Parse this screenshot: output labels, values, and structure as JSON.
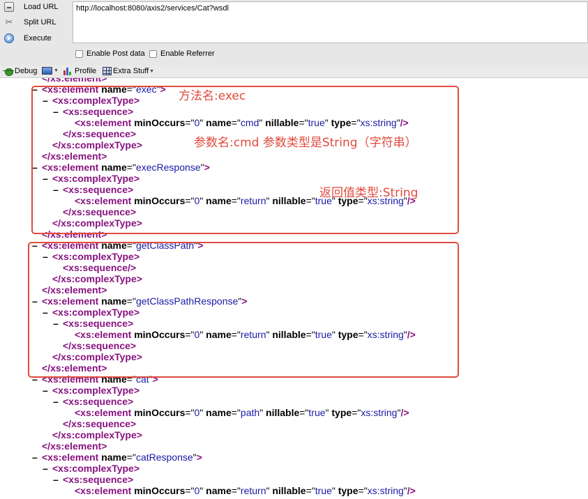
{
  "hackbar": {
    "load_url": "Load URL",
    "split_url": "Split URL",
    "execute": "Execute",
    "url_value": "http://localhost:8080/axis2/services/Cat?wsdl",
    "enable_post": "Enable Post data",
    "enable_referrer": "Enable Referrer"
  },
  "toolbar": {
    "debug": "Debug",
    "profile": "Profile",
    "extra": "Extra Stuff"
  },
  "annotations": {
    "method_name": "方法名:exec",
    "param": "参数名:cmd 参数类型是String（字符串）",
    "return_type": "返回值类型:String"
  },
  "xml_lines": [
    {
      "indent": 60,
      "toggle": "",
      "parts": [
        [
          "t",
          "</xs:element>"
        ]
      ]
    },
    {
      "indent": 60,
      "toggle": "–",
      "parts": [
        [
          "t",
          "<xs:element "
        ],
        [
          "an",
          "name"
        ],
        [
          "pl",
          "=\""
        ],
        [
          "av",
          "exec"
        ],
        [
          "pl",
          "\""
        ],
        [
          "t",
          ">"
        ]
      ]
    },
    {
      "indent": 75,
      "toggle": "–",
      "parts": [
        [
          "t",
          "<xs:complexType>"
        ]
      ]
    },
    {
      "indent": 90,
      "toggle": "–",
      "parts": [
        [
          "t",
          "<xs:sequence>"
        ]
      ]
    },
    {
      "indent": 107,
      "toggle": "",
      "parts": [
        [
          "t",
          "<xs:element "
        ],
        [
          "an",
          "minOccurs"
        ],
        [
          "pl",
          "=\""
        ],
        [
          "av",
          "0"
        ],
        [
          "pl",
          "\" "
        ],
        [
          "an",
          "name"
        ],
        [
          "pl",
          "=\""
        ],
        [
          "av",
          "cmd"
        ],
        [
          "pl",
          "\" "
        ],
        [
          "an",
          "nillable"
        ],
        [
          "pl",
          "=\""
        ],
        [
          "av",
          "true"
        ],
        [
          "pl",
          "\" "
        ],
        [
          "an",
          "type"
        ],
        [
          "pl",
          "=\""
        ],
        [
          "av",
          "xs:string"
        ],
        [
          "pl",
          "\""
        ],
        [
          "t",
          "/>"
        ]
      ]
    },
    {
      "indent": 90,
      "toggle": "",
      "parts": [
        [
          "t",
          "</xs:sequence>"
        ]
      ]
    },
    {
      "indent": 75,
      "toggle": "",
      "parts": [
        [
          "t",
          "</xs:complexType>"
        ]
      ]
    },
    {
      "indent": 60,
      "toggle": "",
      "parts": [
        [
          "t",
          "</xs:element>"
        ]
      ]
    },
    {
      "indent": 60,
      "toggle": "–",
      "parts": [
        [
          "t",
          "<xs:element "
        ],
        [
          "an",
          "name"
        ],
        [
          "pl",
          "=\""
        ],
        [
          "av",
          "execResponse"
        ],
        [
          "pl",
          "\""
        ],
        [
          "t",
          ">"
        ]
      ]
    },
    {
      "indent": 75,
      "toggle": "–",
      "parts": [
        [
          "t",
          "<xs:complexType>"
        ]
      ]
    },
    {
      "indent": 90,
      "toggle": "–",
      "parts": [
        [
          "t",
          "<xs:sequence>"
        ]
      ]
    },
    {
      "indent": 107,
      "toggle": "",
      "parts": [
        [
          "t",
          "<xs:element "
        ],
        [
          "an",
          "minOccurs"
        ],
        [
          "pl",
          "=\""
        ],
        [
          "av",
          "0"
        ],
        [
          "pl",
          "\" "
        ],
        [
          "an",
          "name"
        ],
        [
          "pl",
          "=\""
        ],
        [
          "av",
          "return"
        ],
        [
          "pl",
          "\" "
        ],
        [
          "an",
          "nillable"
        ],
        [
          "pl",
          "=\""
        ],
        [
          "av",
          "true"
        ],
        [
          "pl",
          "\" "
        ],
        [
          "an",
          "type"
        ],
        [
          "pl",
          "=\""
        ],
        [
          "av",
          "xs:string"
        ],
        [
          "pl",
          "\""
        ],
        [
          "t",
          "/>"
        ]
      ]
    },
    {
      "indent": 90,
      "toggle": "",
      "parts": [
        [
          "t",
          "</xs:sequence>"
        ]
      ]
    },
    {
      "indent": 75,
      "toggle": "",
      "parts": [
        [
          "t",
          "</xs:complexType>"
        ]
      ]
    },
    {
      "indent": 60,
      "toggle": "",
      "parts": [
        [
          "t",
          "</xs:element>"
        ]
      ]
    },
    {
      "indent": 60,
      "toggle": "–",
      "parts": [
        [
          "t",
          "<xs:element "
        ],
        [
          "an",
          "name"
        ],
        [
          "pl",
          "=\""
        ],
        [
          "av",
          "getClassPath"
        ],
        [
          "pl",
          "\""
        ],
        [
          "t",
          ">"
        ]
      ]
    },
    {
      "indent": 75,
      "toggle": "–",
      "parts": [
        [
          "t",
          "<xs:complexType>"
        ]
      ]
    },
    {
      "indent": 90,
      "toggle": "",
      "parts": [
        [
          "t",
          "<xs:sequence/>"
        ]
      ]
    },
    {
      "indent": 75,
      "toggle": "",
      "parts": [
        [
          "t",
          "</xs:complexType>"
        ]
      ]
    },
    {
      "indent": 60,
      "toggle": "",
      "parts": [
        [
          "t",
          "</xs:element>"
        ]
      ]
    },
    {
      "indent": 60,
      "toggle": "–",
      "parts": [
        [
          "t",
          "<xs:element "
        ],
        [
          "an",
          "name"
        ],
        [
          "pl",
          "=\""
        ],
        [
          "av",
          "getClassPathResponse"
        ],
        [
          "pl",
          "\""
        ],
        [
          "t",
          ">"
        ]
      ]
    },
    {
      "indent": 75,
      "toggle": "–",
      "parts": [
        [
          "t",
          "<xs:complexType>"
        ]
      ]
    },
    {
      "indent": 90,
      "toggle": "–",
      "parts": [
        [
          "t",
          "<xs:sequence>"
        ]
      ]
    },
    {
      "indent": 107,
      "toggle": "",
      "parts": [
        [
          "t",
          "<xs:element "
        ],
        [
          "an",
          "minOccurs"
        ],
        [
          "pl",
          "=\""
        ],
        [
          "av",
          "0"
        ],
        [
          "pl",
          "\" "
        ],
        [
          "an",
          "name"
        ],
        [
          "pl",
          "=\""
        ],
        [
          "av",
          "return"
        ],
        [
          "pl",
          "\" "
        ],
        [
          "an",
          "nillable"
        ],
        [
          "pl",
          "=\""
        ],
        [
          "av",
          "true"
        ],
        [
          "pl",
          "\" "
        ],
        [
          "an",
          "type"
        ],
        [
          "pl",
          "=\""
        ],
        [
          "av",
          "xs:string"
        ],
        [
          "pl",
          "\""
        ],
        [
          "t",
          "/>"
        ]
      ]
    },
    {
      "indent": 90,
      "toggle": "",
      "parts": [
        [
          "t",
          "</xs:sequence>"
        ]
      ]
    },
    {
      "indent": 75,
      "toggle": "",
      "parts": [
        [
          "t",
          "</xs:complexType>"
        ]
      ]
    },
    {
      "indent": 60,
      "toggle": "",
      "parts": [
        [
          "t",
          "</xs:element>"
        ]
      ]
    },
    {
      "indent": 60,
      "toggle": "–",
      "parts": [
        [
          "t",
          "<xs:element "
        ],
        [
          "an",
          "name"
        ],
        [
          "pl",
          "=\""
        ],
        [
          "av",
          "cat"
        ],
        [
          "pl",
          "\""
        ],
        [
          "t",
          ">"
        ]
      ]
    },
    {
      "indent": 75,
      "toggle": "–",
      "parts": [
        [
          "t",
          "<xs:complexType>"
        ]
      ]
    },
    {
      "indent": 90,
      "toggle": "–",
      "parts": [
        [
          "t",
          "<xs:sequence>"
        ]
      ]
    },
    {
      "indent": 107,
      "toggle": "",
      "parts": [
        [
          "t",
          "<xs:element "
        ],
        [
          "an",
          "minOccurs"
        ],
        [
          "pl",
          "=\""
        ],
        [
          "av",
          "0"
        ],
        [
          "pl",
          "\" "
        ],
        [
          "an",
          "name"
        ],
        [
          "pl",
          "=\""
        ],
        [
          "av",
          "path"
        ],
        [
          "pl",
          "\" "
        ],
        [
          "an",
          "nillable"
        ],
        [
          "pl",
          "=\""
        ],
        [
          "av",
          "true"
        ],
        [
          "pl",
          "\" "
        ],
        [
          "an",
          "type"
        ],
        [
          "pl",
          "=\""
        ],
        [
          "av",
          "xs:string"
        ],
        [
          "pl",
          "\""
        ],
        [
          "t",
          "/>"
        ]
      ]
    },
    {
      "indent": 90,
      "toggle": "",
      "parts": [
        [
          "t",
          "</xs:sequence>"
        ]
      ]
    },
    {
      "indent": 75,
      "toggle": "",
      "parts": [
        [
          "t",
          "</xs:complexType>"
        ]
      ]
    },
    {
      "indent": 60,
      "toggle": "",
      "parts": [
        [
          "t",
          "</xs:element>"
        ]
      ]
    },
    {
      "indent": 60,
      "toggle": "–",
      "parts": [
        [
          "t",
          "<xs:element "
        ],
        [
          "an",
          "name"
        ],
        [
          "pl",
          "=\""
        ],
        [
          "av",
          "catResponse"
        ],
        [
          "pl",
          "\""
        ],
        [
          "t",
          ">"
        ]
      ]
    },
    {
      "indent": 75,
      "toggle": "–",
      "parts": [
        [
          "t",
          "<xs:complexType>"
        ]
      ]
    },
    {
      "indent": 90,
      "toggle": "–",
      "parts": [
        [
          "t",
          "<xs:sequence>"
        ]
      ]
    },
    {
      "indent": 107,
      "toggle": "",
      "parts": [
        [
          "t",
          "<xs:element "
        ],
        [
          "an",
          "minOccurs"
        ],
        [
          "pl",
          "=\""
        ],
        [
          "av",
          "0"
        ],
        [
          "pl",
          "\" "
        ],
        [
          "an",
          "name"
        ],
        [
          "pl",
          "=\""
        ],
        [
          "av",
          "return"
        ],
        [
          "pl",
          "\" "
        ],
        [
          "an",
          "nillable"
        ],
        [
          "pl",
          "=\""
        ],
        [
          "av",
          "true"
        ],
        [
          "pl",
          "\" "
        ],
        [
          "an",
          "type"
        ],
        [
          "pl",
          "=\""
        ],
        [
          "av",
          "xs:string"
        ],
        [
          "pl",
          "\""
        ],
        [
          "t",
          "/>"
        ]
      ]
    }
  ]
}
